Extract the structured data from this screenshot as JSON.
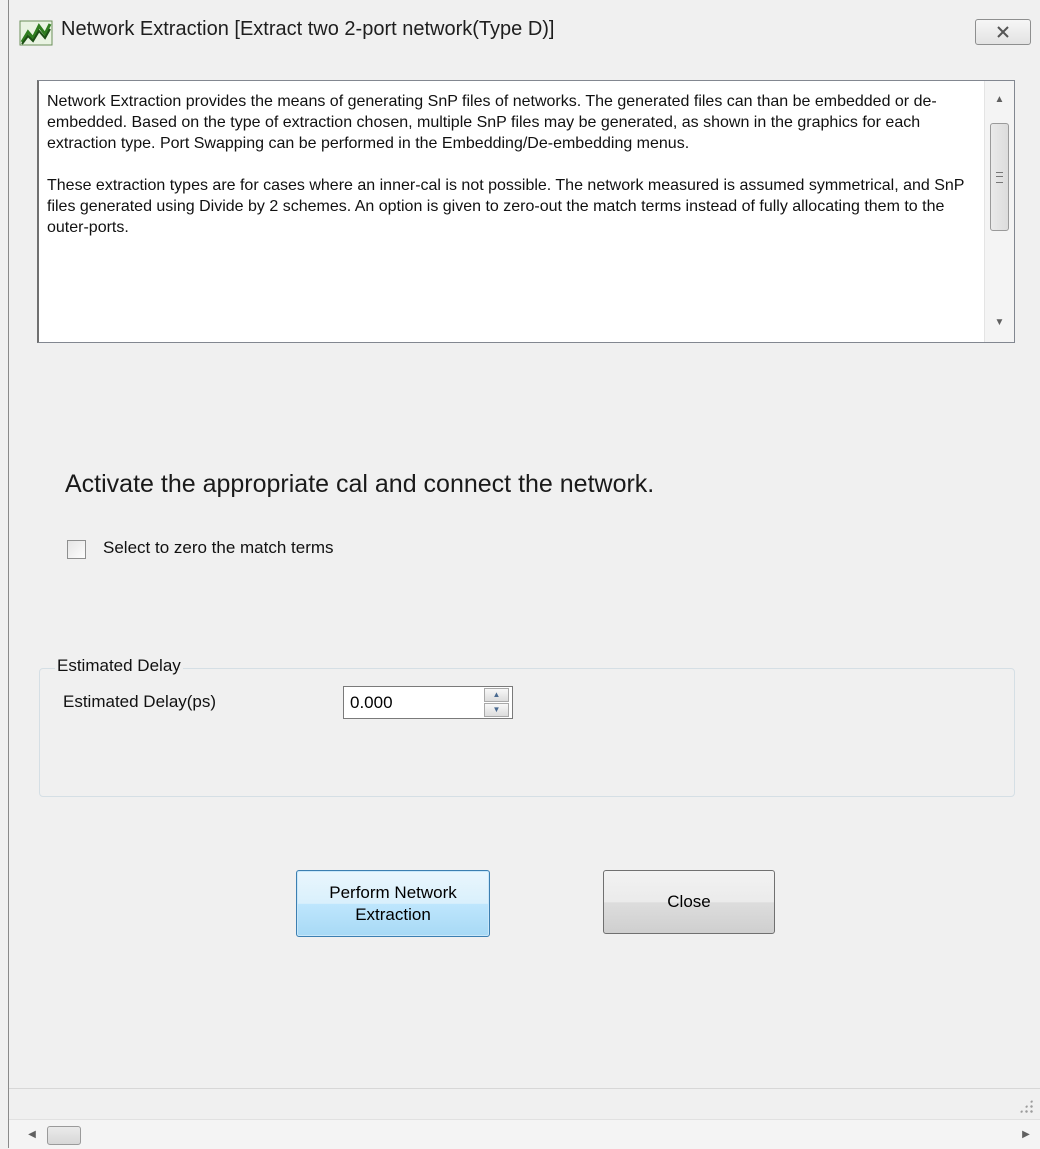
{
  "window": {
    "title": "Network Extraction [Extract two 2-port network(Type D)]"
  },
  "description": {
    "paragraph1": "Network Extraction provides the means of generating SnP files of networks.  The generated files can than be embedded or de-embedded.  Based on the type of extraction chosen, multiple SnP files may be generated, as shown in the graphics for each extraction type.  Port Swapping can be performed in the Embedding/De-embedding menus.",
    "paragraph2": "These extraction types are for cases where an inner-cal is not possible.  The network measured is assumed symmetrical, and  SnP files generated using Divide by 2 schemes.  An option is given to zero-out the match terms instead of fully allocating them to the outer-ports."
  },
  "instruction": "Activate the appropriate cal and connect the network.",
  "zero_match": {
    "label": "Select to zero the match terms",
    "checked": false
  },
  "estimated_delay": {
    "group_title": "Estimated Delay",
    "field_label": "Estimated Delay(ps)",
    "value": "0.000"
  },
  "buttons": {
    "perform": "Perform Network\nExtraction",
    "close": "Close"
  },
  "colors": {
    "window_bg": "#f0f0f0",
    "default_button_border": "#3c7fb1",
    "default_button_fill": "#bee6fd"
  },
  "icons": {
    "app": "network-extraction-app-icon",
    "close": "close-x-icon"
  }
}
